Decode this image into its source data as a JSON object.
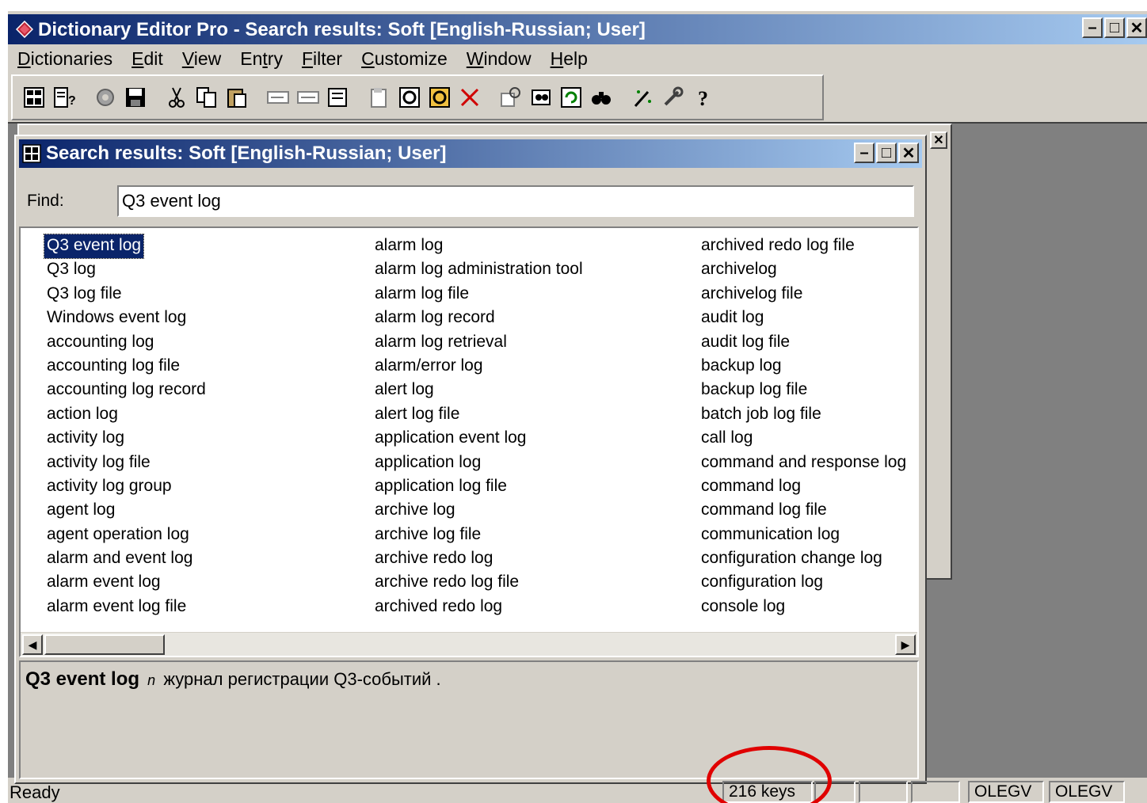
{
  "window": {
    "title": "Dictionary Editor Pro - Search results: Soft [English-Russian; User]",
    "icon": "book-icon"
  },
  "menu": [
    {
      "label": "Dictionaries",
      "accel": "D"
    },
    {
      "label": "Edit",
      "accel": "E"
    },
    {
      "label": "View",
      "accel": "V"
    },
    {
      "label": "Entry",
      "accel": "t"
    },
    {
      "label": "Filter",
      "accel": "F"
    },
    {
      "label": "Customize",
      "accel": "C"
    },
    {
      "label": "Window",
      "accel": "W"
    },
    {
      "label": "Help",
      "accel": "H"
    }
  ],
  "toolbar_icons": [
    "dictionary-list-icon",
    "dictionary-info-icon",
    "settings-icon",
    "save-icon",
    "cut-icon",
    "copy-icon",
    "paste-icon",
    "view-mode-1-icon",
    "view-mode-2-icon",
    "view-mode-3-icon",
    "new-entry-icon",
    "edit-entry-icon",
    "entry-card-icon",
    "delete-icon",
    "find-replace-icon",
    "find-icon",
    "refresh-icon",
    "binoculars-icon",
    "magic-wand-icon",
    "tools-icon",
    "help-icon"
  ],
  "search_window": {
    "title": "Search results: Soft [English-Russian; User]",
    "find_label": "Find:",
    "find_value": "Q3 event log"
  },
  "results": {
    "columns": [
      [
        "Q3 event log",
        "Q3 log",
        "Q3 log file",
        "Windows event log",
        "accounting log",
        "accounting log file",
        "accounting log record",
        "action log",
        "activity log",
        "activity log file",
        "activity log group",
        "agent log",
        "agent operation log",
        "alarm and event log",
        "alarm event log",
        "alarm event log file"
      ],
      [
        "alarm log",
        "alarm log administration tool",
        "alarm log file",
        "alarm log record",
        "alarm log retrieval",
        "alarm/error log",
        "alert log",
        "alert log file",
        "application event log",
        "application log",
        "application log file",
        "archive log",
        "archive log file",
        "archive redo log",
        "archive redo log file",
        "archived redo log"
      ],
      [
        "archived redo log file",
        "archivelog",
        "archivelog file",
        "audit log",
        "audit log file",
        "backup log",
        "backup log file",
        "batch job log file",
        "call log",
        "command and response log",
        "command log",
        "command log file",
        "communication log",
        "configuration change log",
        "configuration log",
        "console log"
      ]
    ],
    "selected": "Q3 event log"
  },
  "definition": {
    "term": "Q3 event log",
    "pos": "n",
    "translation": "журнал регистрации Q3-событий ."
  },
  "status": {
    "ready": "Ready",
    "keys": "216 keys",
    "user1": "OLEGV",
    "user2": "OLEGV"
  }
}
